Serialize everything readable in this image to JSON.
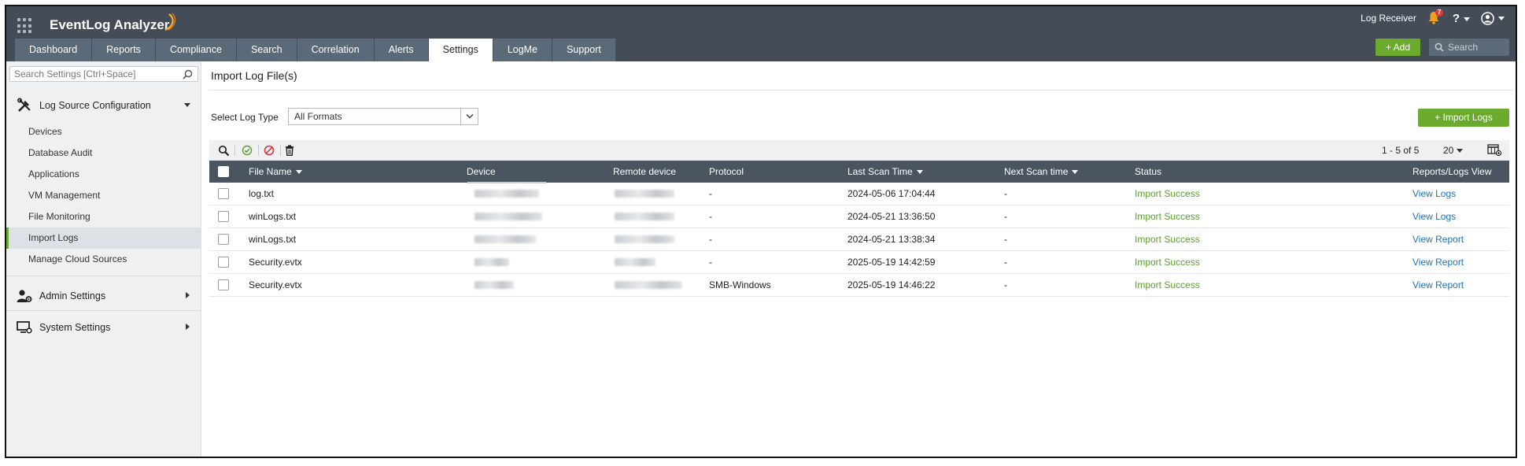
{
  "app": {
    "title": "EventLog Analyzer"
  },
  "header": {
    "log_receiver": "Log Receiver",
    "notification_count": "7",
    "help": "?",
    "add_label": "+ Add",
    "search_placeholder": "Search"
  },
  "tabs": [
    {
      "label": "Dashboard"
    },
    {
      "label": "Reports"
    },
    {
      "label": "Compliance"
    },
    {
      "label": "Search"
    },
    {
      "label": "Correlation"
    },
    {
      "label": "Alerts"
    },
    {
      "label": "Settings",
      "active": true
    },
    {
      "label": "LogMe"
    },
    {
      "label": "Support"
    }
  ],
  "sidebar": {
    "search_placeholder": "Search Settings [Ctrl+Space]",
    "log_source": {
      "label": "Log Source Configuration",
      "items": [
        {
          "label": "Devices"
        },
        {
          "label": "Database Audit"
        },
        {
          "label": "Applications"
        },
        {
          "label": "VM Management"
        },
        {
          "label": "File Monitoring"
        },
        {
          "label": "Import Logs",
          "active": true
        },
        {
          "label": "Manage Cloud Sources"
        }
      ]
    },
    "admin": {
      "label": "Admin Settings"
    },
    "system": {
      "label": "System Settings"
    }
  },
  "main": {
    "title": "Import Log File(s)",
    "select_label": "Select Log Type",
    "select_value": "All Formats",
    "import_button": "+ Import Logs",
    "pager": "1 - 5 of 5",
    "page_size": "20",
    "columns": {
      "file_name": "File Name",
      "device": "Device",
      "remote_device": "Remote device",
      "protocol": "Protocol",
      "last_scan": "Last Scan Time",
      "next_scan": "Next Scan time",
      "status": "Status",
      "reports": "Reports/Logs View"
    },
    "rows": [
      {
        "file": "log.txt",
        "protocol": "-",
        "last_scan": "2024-05-06 17:04:44",
        "next_scan": "-",
        "status": "Import Success",
        "action": "View Logs"
      },
      {
        "file": "winLogs.txt",
        "protocol": "-",
        "last_scan": "2024-05-21 13:36:50",
        "next_scan": "-",
        "status": "Import Success",
        "action": "View Logs"
      },
      {
        "file": "winLogs.txt",
        "protocol": "-",
        "last_scan": "2024-05-21 13:38:34",
        "next_scan": "-",
        "status": "Import Success",
        "action": "View Report"
      },
      {
        "file": "Security.evtx",
        "protocol": "-",
        "last_scan": "2025-05-19 14:42:59",
        "next_scan": "-",
        "status": "Import Success",
        "action": "View Report"
      },
      {
        "file": "Security.evtx",
        "protocol": "SMB-Windows",
        "last_scan": "2025-05-19 14:46:22",
        "next_scan": "-",
        "status": "Import Success",
        "action": "View Report"
      }
    ]
  },
  "colors": {
    "topbar": "#444d57",
    "tab": "#5b6a78",
    "accent_green": "#6aab2e",
    "table_header": "#4a5561",
    "link": "#1d72b8"
  },
  "icons": [
    "apps-grid-icon",
    "bell-icon",
    "help-icon",
    "user-icon",
    "search-icon",
    "tools-icon",
    "admin-user-gear-icon",
    "monitor-gear-icon",
    "enable-icon",
    "disable-icon",
    "trash-icon",
    "column-chooser-icon"
  ]
}
